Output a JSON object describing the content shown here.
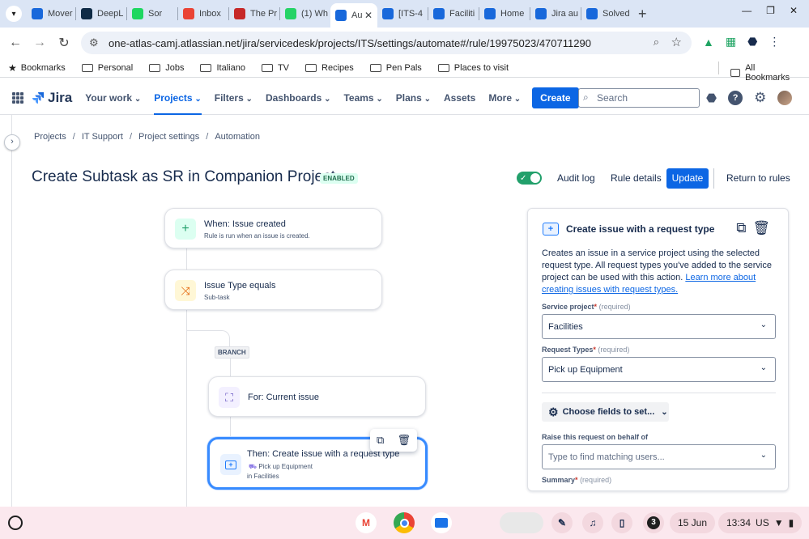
{
  "browser": {
    "tabs": [
      {
        "title": "Mover",
        "fav_color": "#1868db",
        "active": false
      },
      {
        "title": "DeepL",
        "fav_color": "#0f2b46",
        "active": false
      },
      {
        "title": "Sor",
        "fav_color": "#1ed760",
        "active": false
      },
      {
        "title": "Inbox",
        "fav_color": "#ea4335",
        "active": false
      },
      {
        "title": "The Pr",
        "fav_color": "#c62828",
        "active": false
      },
      {
        "title": "(1) Wh",
        "fav_color": "#25d366",
        "active": false
      },
      {
        "title": "Au",
        "fav_color": "#1868db",
        "active": true
      },
      {
        "title": "[ITS-4",
        "fav_color": "#1868db",
        "active": false
      },
      {
        "title": "Faciliti",
        "fav_color": "#1868db",
        "active": false
      },
      {
        "title": "Home",
        "fav_color": "#1868db",
        "active": false
      },
      {
        "title": "Jira au",
        "fav_color": "#1868db",
        "active": false
      },
      {
        "title": "Solved",
        "fav_color": "#1868db",
        "active": false
      }
    ],
    "url": "one-atlas-camj.atlassian.net/jira/servicedesk/projects/ITS/settings/automate#/rule/19975023/470711290",
    "bookmarks": [
      {
        "label": "Bookmarks",
        "icon": "star-icon"
      },
      {
        "label": "Personal",
        "icon": "folder-icon"
      },
      {
        "label": "Jobs",
        "icon": "folder-icon"
      },
      {
        "label": "Italiano",
        "icon": "folder-icon"
      },
      {
        "label": "TV",
        "icon": "folder-icon"
      },
      {
        "label": "Recipes",
        "icon": "folder-icon"
      },
      {
        "label": "Pen Pals",
        "icon": "folder-icon"
      },
      {
        "label": "Places to visit",
        "icon": "folder-icon"
      }
    ],
    "all_bookmarks": "All Bookmarks"
  },
  "jira": {
    "logo": "Jira",
    "nav": [
      "Your work",
      "Projects",
      "Filters",
      "Dashboards",
      "Teams",
      "Plans",
      "Assets",
      "More"
    ],
    "active_nav": "Projects",
    "create": "Create",
    "search_placeholder": "Search"
  },
  "page": {
    "breadcrumbs": [
      "Projects",
      "IT Support",
      "Project settings",
      "Automation"
    ],
    "title": "Create Subtask as SR in Companion Project",
    "status": "ENABLED",
    "audit_log": "Audit log",
    "rule_details": "Rule details",
    "update": "Update",
    "return": "Return to rules"
  },
  "flow": {
    "trigger_title": "When: Issue created",
    "trigger_sub": "Rule is run when an issue is created.",
    "condition_title": "Issue Type equals",
    "condition_sub": "Sub-task",
    "branch": "BRANCH",
    "branch_title": "For: Current issue",
    "action_title": "Then: Create issue with a request type",
    "action_sub1": "Pick up Equipment",
    "action_sub2": "in Facilities"
  },
  "panel": {
    "title": "Create issue with a request type",
    "desc": "Creates an issue in a service project using the selected request type. All request types you've added to the service project can be used with this action. ",
    "link": "Learn more about creating issues with request types.",
    "service_project_label": "Service project",
    "service_project_value": "Facilities",
    "request_types_label": "Request Types",
    "request_types_value": "Pick up Equipment",
    "required": "(required)",
    "choose_fields": "Choose fields to set...",
    "behalf_label": "Raise this request on behalf of",
    "behalf_placeholder": "Type to find matching users...",
    "summary_label": "Summary"
  },
  "shelf": {
    "date": "15 Jun",
    "time": "13:34",
    "locale": "US",
    "notif_count": "3"
  }
}
